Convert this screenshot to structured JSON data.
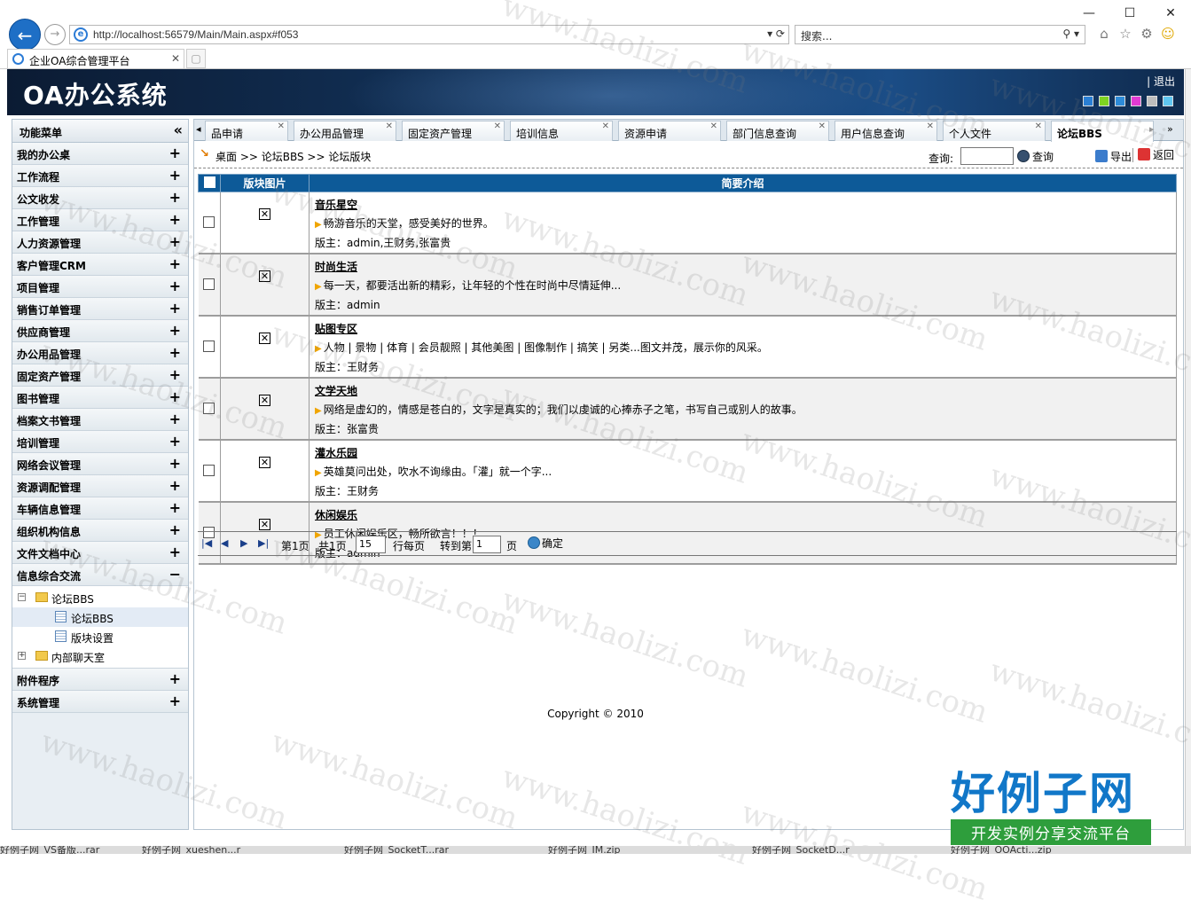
{
  "browser": {
    "url": "http://localhost:56579/Main/Main.aspx#f053",
    "search_placeholder": "搜索...",
    "tab_title": "企业OA综合管理平台",
    "window_buttons": [
      "—",
      "☐",
      "✕"
    ]
  },
  "header": {
    "app_title": "OA办公系统",
    "logout": "退出",
    "skin_colors": [
      "#2a7fd4",
      "#7ed321",
      "#2d8bd8",
      "#e23bd4",
      "#bdbdbd",
      "#5fc6f0"
    ]
  },
  "sidebar": {
    "title": "功能菜单",
    "collapse_icon": "«",
    "items_top": [
      {
        "label": "我的办公桌",
        "sign": "+"
      },
      {
        "label": "工作流程",
        "sign": "+"
      },
      {
        "label": "公文收发",
        "sign": "+"
      },
      {
        "label": "工作管理",
        "sign": "+"
      },
      {
        "label": "人力资源管理",
        "sign": "+"
      },
      {
        "label": "客户管理CRM",
        "sign": "+"
      },
      {
        "label": "项目管理",
        "sign": "+"
      },
      {
        "label": "销售订单管理",
        "sign": "+"
      },
      {
        "label": "供应商管理",
        "sign": "+"
      },
      {
        "label": "办公用品管理",
        "sign": "+"
      },
      {
        "label": "固定资产管理",
        "sign": "+"
      },
      {
        "label": "图书管理",
        "sign": "+"
      },
      {
        "label": "档案文书管理",
        "sign": "+"
      },
      {
        "label": "培训管理",
        "sign": "+"
      },
      {
        "label": "网络会议管理",
        "sign": "+"
      },
      {
        "label": "资源调配管理",
        "sign": "+"
      },
      {
        "label": "车辆信息管理",
        "sign": "+"
      },
      {
        "label": "组织机构信息",
        "sign": "+"
      },
      {
        "label": "文件文档中心",
        "sign": "+"
      },
      {
        "label": "信息综合交流",
        "sign": "−"
      }
    ],
    "tree": {
      "forum": "论坛BBS",
      "forum_child": "论坛BBS",
      "block_settings": "版块设置",
      "chatroom": "内部聊天室"
    },
    "items_bottom": [
      {
        "label": "附件程序",
        "sign": "+"
      },
      {
        "label": "系统管理",
        "sign": "+"
      }
    ]
  },
  "main": {
    "tabs": [
      "品申请",
      "办公用品管理",
      "固定资产管理",
      "培训信息",
      "资源申请",
      "部门信息查询",
      "用户信息查询",
      "个人文件",
      "论坛BBS"
    ],
    "breadcrumb": "桌面 >> 论坛BBS >> 论坛版块",
    "query_label": "查询:",
    "query_button": "查询",
    "export_button": "导出",
    "back_button": "返回",
    "columns": [
      "版块图片",
      "简要介绍"
    ],
    "rows": [
      {
        "name": "音乐星空",
        "intro": "畅游音乐的天堂，感受美好的世界。",
        "mods": "版主：admin,王财务,张富贵"
      },
      {
        "name": "时尚生活",
        "intro": "每一天，都要活出新的精彩，让年轻的个性在时尚中尽情延伸...",
        "mods": "版主：admin"
      },
      {
        "name": "贴图专区",
        "intro": "人物 | 景物 | 体育 | 会员靓照 | 其他美图 | 图像制作 | 搞笑 | 另类...图文并茂，展示你的风采。",
        "mods": "版主：王财务"
      },
      {
        "name": "文学天地",
        "intro": "网络是虚幻的，情感是苍白的，文字是真实的；我们以虔诚的心捧赤子之笔，书写自己或别人的故事。",
        "mods": "版主：张富贵"
      },
      {
        "name": "灌水乐园",
        "intro": "英雄莫问出处，吹水不询缘由。「灌」就一个字...",
        "mods": "版主：王财务"
      },
      {
        "name": "休闲娱乐",
        "intro": "员工休闲娱乐区，畅所欲言！！！",
        "mods": "版主：admin"
      }
    ],
    "pager": {
      "page_text": "第1页",
      "total_text": "共1页",
      "per_page": "15",
      "per_page_label": "行每页",
      "goto_label": "转到第",
      "goto_value": "1",
      "page_unit": "页",
      "confirm": "确定"
    },
    "copyright": "Copyright © 2010"
  },
  "watermark": {
    "text": "www.haolizi.com",
    "brand_title": "好例子网",
    "brand_sub": "开发实例分享交流平台"
  },
  "taskbar": [
    "好例子网_VS备版...rar",
    "好例子网_xueshen...r",
    "好例子网_SocketT...rar",
    "好例子网_IM.zip",
    "好例子网_SocketD...r",
    "好例子网_OOActi...zip"
  ]
}
